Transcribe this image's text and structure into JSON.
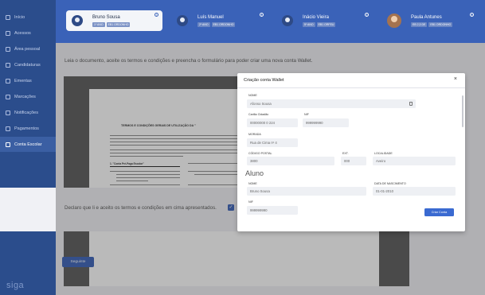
{
  "sidebar": {
    "items": [
      {
        "label": "Início"
      },
      {
        "label": "Acessos"
      },
      {
        "label": "Área pessoal"
      },
      {
        "label": "Candidaturas"
      },
      {
        "label": "Ementas"
      },
      {
        "label": "Marcações"
      },
      {
        "label": "Notificações"
      },
      {
        "label": "Pagamentos"
      },
      {
        "label": "Conta Escolar"
      }
    ],
    "brand": "siga"
  },
  "header": {
    "cards": [
      {
        "name": "Bruno Sousa",
        "tags": [
          "1º ANO",
          "EB1 ORDONHO"
        ]
      },
      {
        "name": "Luís Manuel",
        "tags": [
          "2º ANO",
          "EB1 ORDONHO"
        ]
      },
      {
        "name": "Inácio Vieira",
        "tags": [
          "5º ANO",
          "EB1 ORFEU"
        ]
      },
      {
        "name": "Paula Antunes",
        "tags": [
          "EB 2,3 DE",
          "EB1 ORDONHO"
        ]
      }
    ]
  },
  "main": {
    "instruction": "Leia o documento, aceite os termos e condições e preencha o formulário para poder criar uma nova conta Wallet.",
    "document_title": "TERMOS E CONDIÇÕES GERAIS DE UTILIZAÇÃO DA \"",
    "section1_heading": "1.    \"Conta Pré-Paga Escolar\"",
    "declare_text": "Declaro que li e aceito os termos e condições em cima apresentados.",
    "next_button": "Seguinte"
  },
  "modal": {
    "title": "Criação conta Wallet",
    "close": "×",
    "fields": {
      "nome_label": "NOME",
      "nome_value": "Afonso Sousa",
      "cc_label": "Cartão Cidadão",
      "cc_value": "00000000 0 224",
      "nif_label": "NIF",
      "nif_value": "999999990",
      "morada_label": "MORADA",
      "morada_value": "Rua de Cima nº 4",
      "cp_label": "CÓDIGO POSTAL",
      "cp_value": "3800",
      "ext_label": "EXT.",
      "ext_value": "000",
      "loc_label": "LOCALIDADE",
      "loc_value": "Aveiro"
    },
    "student_section": "Aluno",
    "student": {
      "nome_label": "NOME",
      "nome_value": "Bruno Sousa",
      "dob_label": "DATA DE NASCIMENTO",
      "dob_value": "01-01-2010",
      "nif_label": "NIF",
      "nif_value": "999999990"
    },
    "create_button": "Criar Conta"
  }
}
